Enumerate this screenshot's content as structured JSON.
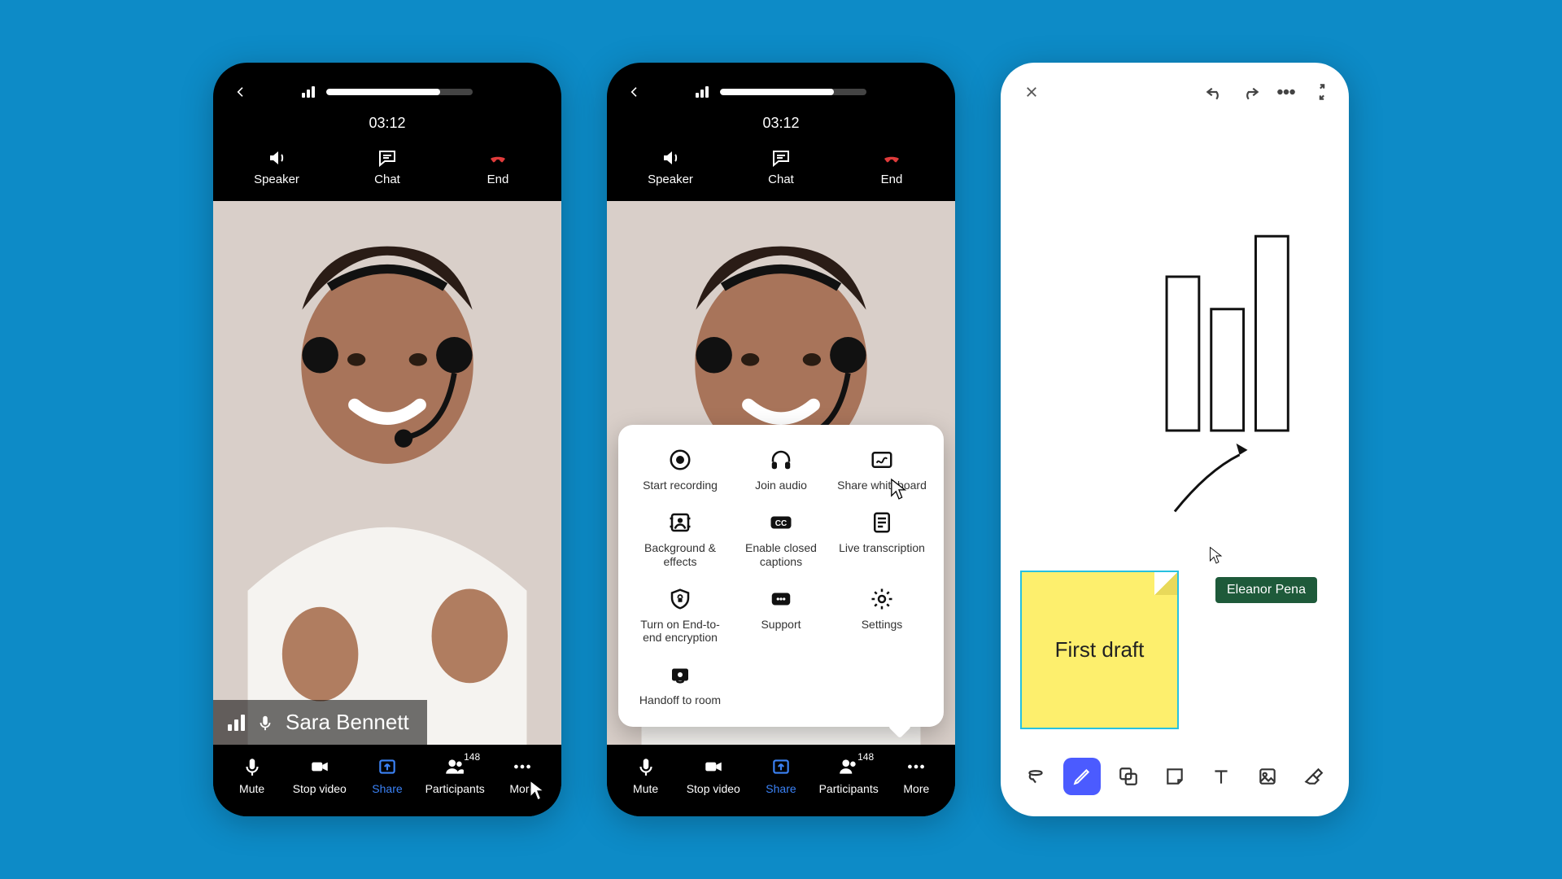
{
  "call": {
    "timer": "03:12",
    "top_actions": {
      "speaker": "Speaker",
      "chat": "Chat",
      "end": "End"
    },
    "participant_name": "Sara Bennett",
    "bottom_actions": {
      "mute": "Mute",
      "stop_video": "Stop video",
      "share": "Share",
      "participants": "Participants",
      "participants_count": "148",
      "more": "More"
    }
  },
  "more_menu": {
    "start_recording": "Start recording",
    "join_audio": "Join audio",
    "share_whiteboard": "Share whiteboard",
    "background_effects": "Background & effects",
    "enable_cc": "Enable closed captions",
    "live_transcription": "Live transcription",
    "e2ee": "Turn on End-to-end encryption",
    "support": "Support",
    "settings": "Settings",
    "handoff": "Handoff to room"
  },
  "whiteboard": {
    "sticky_text": "First draft",
    "collaborator": "Eleanor Pena"
  }
}
